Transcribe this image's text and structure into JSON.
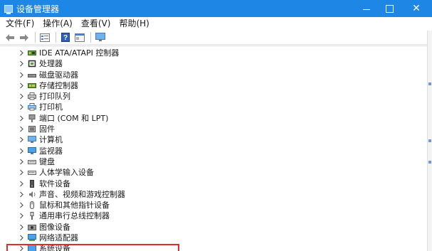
{
  "window": {
    "title": "设备管理器",
    "minimize_label": "—",
    "maximize_label": "□",
    "close_label": "✕"
  },
  "menu": {
    "items": [
      "文件(F)",
      "操作(A)",
      "查看(V)",
      "帮助(H)"
    ]
  },
  "toolbar": {
    "icons": [
      "back-icon",
      "forward-icon",
      "properties-icon",
      "help-icon",
      "view-icon",
      "monitor-icon"
    ]
  },
  "tree": {
    "items": [
      {
        "label": "IDE ATA/ATAPI 控制器",
        "icon": "ide-controller-icon"
      },
      {
        "label": "处理器",
        "icon": "processor-icon"
      },
      {
        "label": "磁盘驱动器",
        "icon": "disk-drive-icon"
      },
      {
        "label": "存储控制器",
        "icon": "storage-controller-icon"
      },
      {
        "label": "打印队列",
        "icon": "print-queue-icon"
      },
      {
        "label": "打印机",
        "icon": "printer-icon"
      },
      {
        "label": "端口 (COM 和 LPT)",
        "icon": "port-icon"
      },
      {
        "label": "固件",
        "icon": "firmware-icon"
      },
      {
        "label": "计算机",
        "icon": "computer-icon"
      },
      {
        "label": "监视器",
        "icon": "monitor-icon"
      },
      {
        "label": "键盘",
        "icon": "keyboard-icon"
      },
      {
        "label": "人体学输入设备",
        "icon": "hid-icon"
      },
      {
        "label": "软件设备",
        "icon": "software-device-icon"
      },
      {
        "label": "声音、视频和游戏控制器",
        "icon": "sound-icon"
      },
      {
        "label": "鼠标和其他指针设备",
        "icon": "mouse-icon"
      },
      {
        "label": "通用串行总线控制器",
        "icon": "usb-icon"
      },
      {
        "label": "图像设备",
        "icon": "camera-icon"
      },
      {
        "label": "网络适配器",
        "icon": "network-adapter-icon"
      },
      {
        "label": "系统设备",
        "icon": "system-device-icon"
      }
    ]
  },
  "colors": {
    "titlebar": "#1e87e5",
    "highlight_border": "#e22b2b"
  }
}
